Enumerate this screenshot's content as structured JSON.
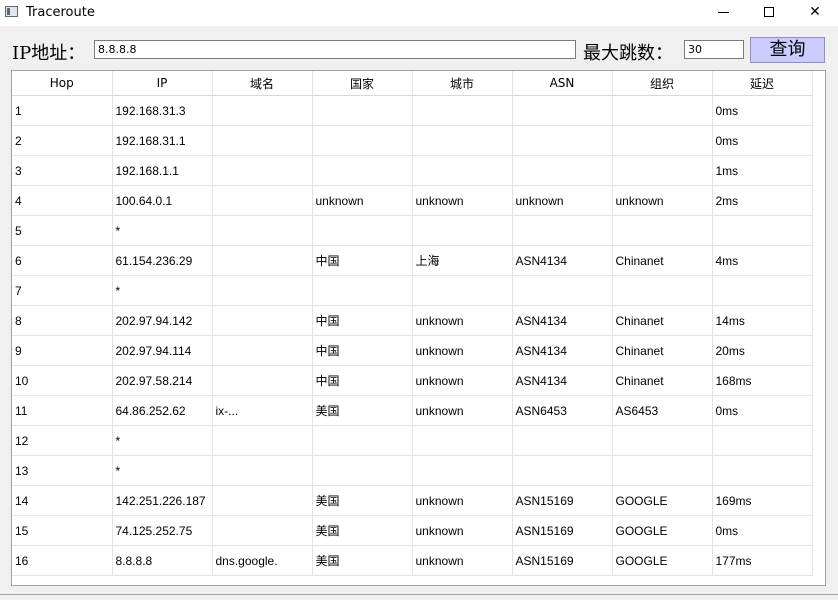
{
  "window": {
    "title": "Traceroute",
    "min_glyph": "",
    "max_glyph": "",
    "close_glyph": "✕"
  },
  "toolbar": {
    "ip_label": "IP地址：",
    "ip_value": "8.8.8.8",
    "hops_label": "最大跳数：",
    "hops_value": "30",
    "query_label": "查询"
  },
  "table": {
    "headers": [
      "Hop",
      "IP",
      "域名",
      "国家",
      "城市",
      "ASN",
      "组织",
      "延迟"
    ],
    "rows": [
      [
        "1",
        "192.168.31.3",
        "",
        "",
        "",
        "",
        "",
        "0ms"
      ],
      [
        "2",
        "192.168.31.1",
        "",
        "",
        "",
        "",
        "",
        "0ms"
      ],
      [
        "3",
        "192.168.1.1",
        "",
        "",
        "",
        "",
        "",
        "1ms"
      ],
      [
        "4",
        "100.64.0.1",
        "",
        "unknown",
        "unknown",
        "unknown",
        "unknown",
        "2ms"
      ],
      [
        "5",
        "*",
        "",
        "",
        "",
        "",
        "",
        ""
      ],
      [
        "6",
        "61.154.236.29",
        "",
        "中国",
        "上海",
        "ASN4134",
        "Chinanet",
        "4ms"
      ],
      [
        "7",
        "*",
        "",
        "",
        "",
        "",
        "",
        ""
      ],
      [
        "8",
        "202.97.94.142",
        "",
        "中国",
        "unknown",
        "ASN4134",
        "Chinanet",
        "14ms"
      ],
      [
        "9",
        "202.97.94.114",
        "",
        "中国",
        "unknown",
        "ASN4134",
        "Chinanet",
        "20ms"
      ],
      [
        "10",
        "202.97.58.214",
        "",
        "中国",
        "unknown",
        "ASN4134",
        "Chinanet",
        "168ms"
      ],
      [
        "11",
        "64.86.252.62",
        "ix-...",
        "美国",
        "unknown",
        "ASN6453",
        "AS6453",
        "0ms"
      ],
      [
        "12",
        "*",
        "",
        "",
        "",
        "",
        "",
        ""
      ],
      [
        "13",
        "*",
        "",
        "",
        "",
        "",
        "",
        ""
      ],
      [
        "14",
        "142.251.226.187",
        "",
        "美国",
        "unknown",
        "ASN15169",
        "GOOGLE",
        "169ms"
      ],
      [
        "15",
        "74.125.252.75",
        "",
        "美国",
        "unknown",
        "ASN15169",
        "GOOGLE",
        "0ms"
      ],
      [
        "16",
        "8.8.8.8",
        "dns.google.",
        "美国",
        "unknown",
        "ASN15169",
        "GOOGLE",
        "177ms"
      ]
    ]
  }
}
